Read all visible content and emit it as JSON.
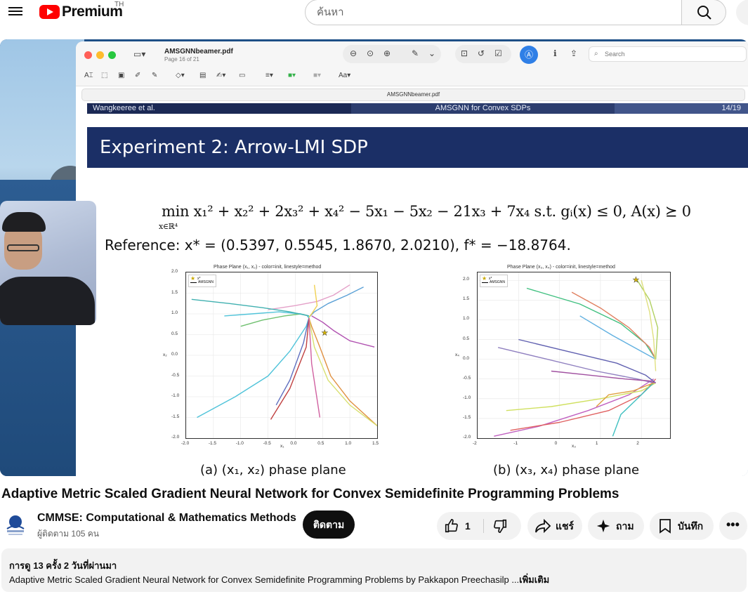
{
  "header": {
    "logo_text": "Premium",
    "country_code": "TH",
    "search_placeholder": "ค้นหา"
  },
  "pdf_viewer": {
    "filename": "AMSGNNbeamer.pdf",
    "page_info": "Page 16 of 21",
    "address_bar": "AMSGNNbeamer.pdf",
    "search_label": "Search",
    "format_label": "Aa"
  },
  "slide": {
    "header_left": "Wangkeeree et al.",
    "header_center": "AMSGNN for Convex SDPs",
    "header_right": "14/19",
    "title": "Experiment 2: Arrow-LMI SDP",
    "objective_text": "min x₁² + x₂² + 2x₃² + x₄² − 5x₁ − 5x₂ − 21x₃ + 7x₄  s.t.  gᵢ(x) ≤ 0, A(x) ⪰ 0",
    "objective_subscript": "x∈ℝ⁴",
    "reference_text": "Reference: x* = (0.5397, 0.5545, 1.8670, 2.0210),  f* = −18.8764.",
    "caption_a": "(a) (x₁, x₂) phase plane",
    "caption_b": "(b) (x₃, x₄) phase plane"
  },
  "chart_data": [
    {
      "type": "line",
      "title": "Phase Plane (x₁, x₂) - color=init, linestyle=method",
      "xlabel": "x₁",
      "ylabel": "x₂",
      "xlim": [
        -2.0,
        1.5
      ],
      "ylim": [
        -2.0,
        2.0
      ],
      "xticks": [
        "-2.0",
        "-1.5",
        "-1.0",
        "-0.5",
        "0.0",
        "0.5",
        "1.0",
        "1.5"
      ],
      "yticks": [
        "2.0",
        "1.5",
        "1.0",
        "0.5",
        "0.0",
        "-0.5",
        "-1.0",
        "-1.5",
        "-2.0"
      ],
      "legend": [
        "x*",
        "AMSGNN"
      ],
      "legend_position": "top-left",
      "grid": true,
      "optimum": [
        0.5397,
        0.5545
      ],
      "series": [
        {
          "color": "#4fc3d9",
          "x": [
            -1.8,
            -1.1,
            -0.5,
            -0.1,
            0.2,
            0.25,
            0.22
          ],
          "y": [
            -1.5,
            -1.0,
            -0.5,
            0.1,
            0.7,
            0.9,
            0.95
          ]
        },
        {
          "color": "#5aa0d6",
          "x": [
            1.25,
            0.95,
            0.6,
            0.35,
            0.25
          ],
          "y": [
            1.65,
            1.45,
            1.25,
            1.05,
            0.92
          ]
        },
        {
          "color": "#e4a0c8",
          "x": [
            -0.5,
            0.0,
            0.4,
            0.7,
            1.0
          ],
          "y": [
            1.1,
            1.2,
            1.3,
            1.45,
            1.7
          ]
        },
        {
          "color": "#e09040",
          "x": [
            1.5,
            1.0,
            0.65,
            0.45,
            0.3,
            0.25
          ],
          "y": [
            -1.7,
            -1.1,
            -0.5,
            0.2,
            0.7,
            0.9
          ]
        },
        {
          "color": "#d8e070",
          "x": [
            1.55,
            1.0,
            0.6,
            0.35,
            0.25
          ],
          "y": [
            -1.75,
            -1.2,
            -0.6,
            0.2,
            0.9
          ]
        },
        {
          "color": "#6070c0",
          "x": [
            -0.35,
            -0.1,
            0.15,
            0.25
          ],
          "y": [
            -1.2,
            -0.6,
            0.3,
            0.9
          ]
        },
        {
          "color": "#c04040",
          "x": [
            -0.45,
            -0.1,
            0.2,
            0.25
          ],
          "y": [
            -1.55,
            -0.8,
            0.2,
            0.9
          ]
        },
        {
          "color": "#b050b0",
          "x": [
            1.45,
            1.0,
            0.7,
            0.5,
            0.3
          ],
          "y": [
            0.2,
            0.35,
            0.6,
            0.8,
            0.95
          ]
        },
        {
          "color": "#70c070",
          "x": [
            -1.0,
            -0.6,
            -0.2,
            0.1,
            0.25
          ],
          "y": [
            0.7,
            0.85,
            0.95,
            1.0,
            0.95
          ]
        },
        {
          "color": "#4fc3d9",
          "x": [
            -1.3,
            -0.8,
            -0.3,
            0.1,
            0.25
          ],
          "y": [
            0.95,
            1.0,
            1.05,
            1.0,
            0.95
          ]
        },
        {
          "color": "#40b0b0",
          "x": [
            -1.9,
            -1.2,
            -0.6,
            -0.1,
            0.25
          ],
          "y": [
            1.35,
            1.25,
            1.15,
            1.05,
            0.95
          ]
        },
        {
          "color": "#d060a0",
          "x": [
            0.45,
            0.3,
            0.25
          ],
          "y": [
            -1.5,
            -0.2,
            0.9
          ]
        },
        {
          "color": "#f0d050",
          "x": [
            0.35,
            0.4,
            0.3,
            0.25
          ],
          "y": [
            1.7,
            1.2,
            1.0,
            0.92
          ]
        }
      ]
    },
    {
      "type": "line",
      "title": "Phase Plane (x₃, x₄) - color=init, linestyle=method",
      "xlabel": "x₃",
      "ylabel": "x₄",
      "xlim": [
        -2.0,
        2.7
      ],
      "ylim": [
        -2.0,
        2.2
      ],
      "xticks": [
        "-2",
        "-1",
        "0",
        "1",
        "2"
      ],
      "yticks": [
        "2.0",
        "1.5",
        "1.0",
        "0.5",
        "0.0",
        "-0.5",
        "-1.0",
        "-1.5",
        "-2.0"
      ],
      "legend": [
        "x*",
        "AMSGNN"
      ],
      "legend_position": "top-left",
      "grid": true,
      "optimum": [
        1.867,
        2.021
      ],
      "series": [
        {
          "color": "#40c080",
          "x": [
            -0.8,
            0.5,
            1.5,
            2.1,
            2.35
          ],
          "y": [
            1.8,
            1.4,
            0.9,
            0.4,
            0.0
          ]
        },
        {
          "color": "#e08060",
          "x": [
            0.3,
            1.0,
            1.7,
            2.2,
            2.35
          ],
          "y": [
            1.7,
            1.3,
            0.8,
            0.3,
            0.0
          ]
        },
        {
          "color": "#c060c0",
          "x": [
            -1.6,
            -0.5,
            0.7,
            1.7,
            2.3
          ],
          "y": [
            -1.95,
            -1.7,
            -1.3,
            -0.9,
            -0.5
          ]
        },
        {
          "color": "#e06060",
          "x": [
            -1.2,
            0.0,
            1.2,
            2.0,
            2.35
          ],
          "y": [
            -1.8,
            -1.6,
            -1.3,
            -0.9,
            -0.5
          ]
        },
        {
          "color": "#6060b0",
          "x": [
            -1.0,
            0.2,
            1.4,
            2.1,
            2.35
          ],
          "y": [
            0.5,
            0.2,
            -0.1,
            -0.4,
            -0.6
          ]
        },
        {
          "color": "#9080c0",
          "x": [
            -1.5,
            -0.3,
            0.9,
            1.9,
            2.3
          ],
          "y": [
            0.3,
            0.0,
            -0.3,
            -0.5,
            -0.6
          ]
        },
        {
          "color": "#60b0e0",
          "x": [
            0.5,
            1.3,
            2.0,
            2.35
          ],
          "y": [
            1.1,
            0.6,
            0.2,
            0.0
          ]
        },
        {
          "color": "#d0e060",
          "x": [
            -1.3,
            -0.2,
            1.0,
            2.0,
            2.35
          ],
          "y": [
            -1.3,
            -1.2,
            -1.0,
            -0.8,
            -0.6
          ]
        },
        {
          "color": "#40c0c0",
          "x": [
            1.3,
            1.5,
            1.9,
            2.3
          ],
          "y": [
            -1.95,
            -1.4,
            -1.0,
            -0.6
          ]
        },
        {
          "color": "#e0a040",
          "x": [
            0.9,
            1.2,
            1.8,
            2.3
          ],
          "y": [
            -1.2,
            -0.9,
            -0.8,
            -0.6
          ]
        },
        {
          "color": "#b0d060",
          "x": [
            1.9,
            2.2,
            2.4,
            2.35
          ],
          "y": [
            2.0,
            1.5,
            0.8,
            0.0
          ]
        },
        {
          "color": "#e0e080",
          "x": [
            2.0,
            2.2,
            2.3,
            2.35
          ],
          "y": [
            2.0,
            1.2,
            0.5,
            -0.3
          ]
        },
        {
          "color": "#a050a0",
          "x": [
            -0.2,
            0.7,
            1.6,
            2.2,
            2.35
          ],
          "y": [
            -0.3,
            -0.4,
            -0.5,
            -0.55,
            -0.6
          ]
        }
      ]
    }
  ],
  "video": {
    "title": "Adaptive Metric Scaled Gradient Neural Network for Convex Semidefinite Programming Problems"
  },
  "channel": {
    "name": "CMMSE: Computational & Mathematics Methods",
    "subscribers": "ผู้ติดตาม 105 คน",
    "subscribe_label": "ติดตาม"
  },
  "actions": {
    "like_count": "1",
    "share_label": "แชร์",
    "ask_label": "ถาม",
    "save_label": "บันทึก"
  },
  "description": {
    "meta": "การดู 13 ครั้ง  2 วันที่ผ่านมา",
    "text": "Adaptive Metric Scaled Gradient Neural Network for Convex Semidefinite Programming Problems by Pakkapon Preechasilp ...",
    "more_label": "เพิ่มเติม"
  },
  "colors": {
    "youtube_red": "#ff0000",
    "slide_navy": "#1b2f66",
    "subscribe_black": "#0f0f0f"
  }
}
